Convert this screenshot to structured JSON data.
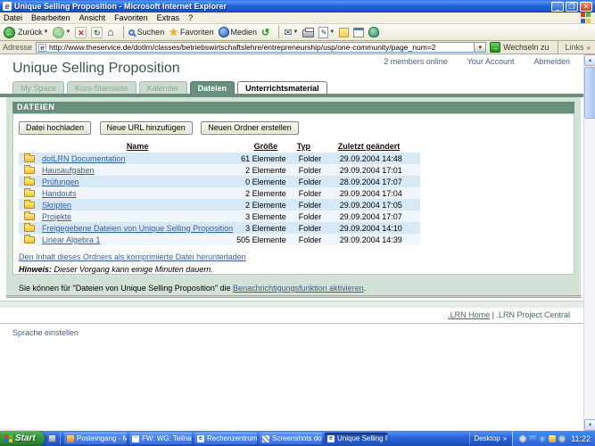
{
  "window": {
    "title": "Unique Selling Proposition - Microsoft Internet Explorer"
  },
  "menu": {
    "items": [
      "Datei",
      "Bearbeiten",
      "Ansicht",
      "Favoriten",
      "Extras",
      "?"
    ]
  },
  "toolbar": {
    "back_label": "Zurück",
    "search_label": "Suchen",
    "favorites_label": "Favoriten",
    "media_label": "Medien"
  },
  "address": {
    "label": "Adresse",
    "url": "http://www.theservice.de/dotlrn/classes/betriebswirtschaftslehre/entrepreneurship/usp/one-community/page_num=2",
    "go_label": "Wechseln zu",
    "links_label": "Links"
  },
  "page": {
    "members_online": "2 members online",
    "your_account": "Your Account",
    "logout": "Abmelden",
    "title": "Unique Selling Proposition",
    "tabs": [
      {
        "label": "My Space",
        "state": "inactive"
      },
      {
        "label": "Kurs-Startseite",
        "state": "inactive"
      },
      {
        "label": "Kalender",
        "state": "inactive"
      },
      {
        "label": "Dateien",
        "state": "active"
      },
      {
        "label": "Unterrichtsmaterial",
        "state": "highlight"
      }
    ],
    "portlet": {
      "header": "DATEIEN",
      "buttons": [
        "Datei hochladen",
        "Neue URL hinzufügen",
        "Neuen Ordner erstellen"
      ],
      "table": {
        "columns": [
          "Name",
          "Größe",
          "Typ",
          "Zuletzt geändert"
        ],
        "rows": [
          {
            "name": "dotLRN Documentation",
            "size": "61 Elemente",
            "type": "Folder",
            "modified": "29.09.2004 14:48"
          },
          {
            "name": "Hausaufgaben",
            "size": "2 Elemente",
            "type": "Folder",
            "modified": "29.09.2004 17:01"
          },
          {
            "name": "Prüfungen",
            "size": "0 Elemente",
            "type": "Folder",
            "modified": "28.09.2004 17:07"
          },
          {
            "name": "Handouts",
            "size": "2 Elemente",
            "type": "Folder",
            "modified": "29.09.2004 17:04"
          },
          {
            "name": "Skripten",
            "size": "2 Elemente",
            "type": "Folder",
            "modified": "29.09.2004 17:05"
          },
          {
            "name": "Projekte",
            "size": "3 Elemente",
            "type": "Folder",
            "modified": "29.09.2004 17:07"
          },
          {
            "name": "Freigegebene Dateien von Unique Selling Proposition",
            "size": "3 Elemente",
            "type": "Folder",
            "modified": "29.09.2004 14:10"
          },
          {
            "name": "Linear Algebra 1",
            "size": "505 Elemente",
            "type": "Folder",
            "modified": "29.09.2004 14:39"
          }
        ]
      },
      "download_link": "Den Inhalt dieses Ordners als komprimierte Datei herunterladen",
      "hint_label": "Hinweis:",
      "hint_text": " Dieser Vorgang kann einige Minuten dauern.",
      "notify_prefix": "Sie können für \"Dateien von Unique Selling Proposition\" die ",
      "notify_link": "Benachrichtigungsfunktion aktivieren",
      "notify_suffix": "."
    },
    "footer": {
      "lrn_home": ".LRN Home",
      "separator": "|",
      "lrn_project": ".LRN Project Central",
      "language_link": "Sprache einstellen"
    }
  },
  "taskbar": {
    "start_label": "Start",
    "tasks": [
      {
        "label": "Posteingang - Micros...",
        "icon": "outlook",
        "active": false
      },
      {
        "label": "FW: WG: Teilnahme v...",
        "icon": "mail",
        "active": false
      },
      {
        "label": "Rechenzentrum Uni K...",
        "icon": "iepage",
        "active": false
      },
      {
        "label": "Screenshots dotLRN...",
        "icon": "shots",
        "active": false
      },
      {
        "label": "Unique Selling Proposi...",
        "icon": "iepage",
        "active": true
      }
    ],
    "desktop_label": "Desktop",
    "clock": "11:22"
  },
  "colors": {
    "accent_green": "#67907b",
    "panel_green": "#d2e2d7",
    "link_blue": "#3c5e9c",
    "row_blue": "#d7e8f6",
    "xp_blue": "#2a62d8",
    "start_green": "#3aa03f"
  }
}
